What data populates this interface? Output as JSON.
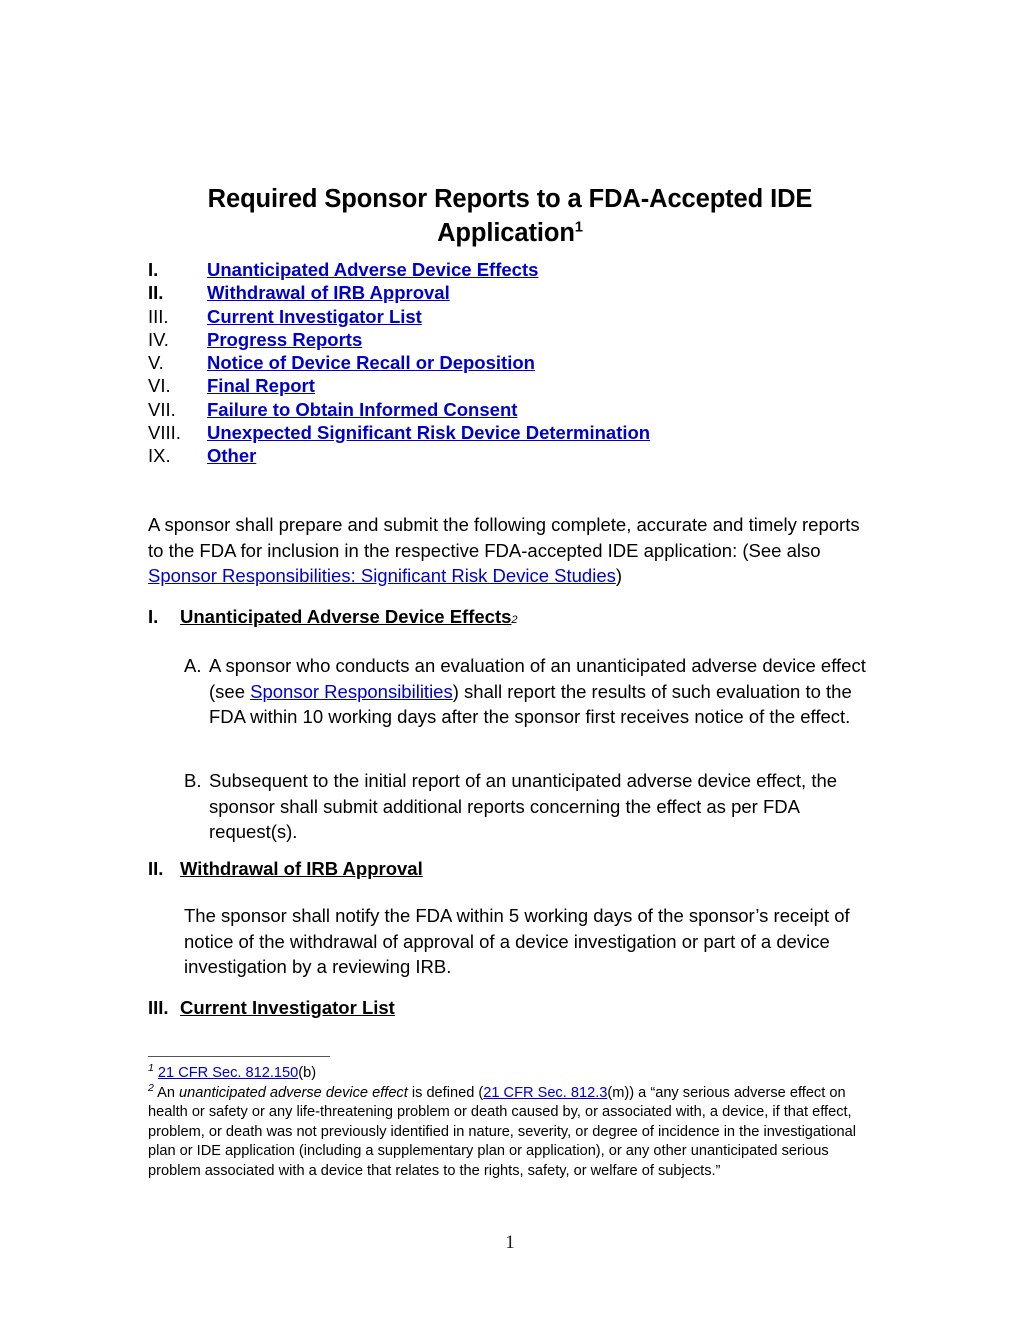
{
  "document": {
    "title_line1": "Required Sponsor Reports to a FDA-Accepted IDE",
    "title_line2": "Application",
    "title_footnote_marker": "1",
    "page_number": "1",
    "link_color": "#0000CC",
    "text_color": "#000000"
  },
  "toc": {
    "items": [
      {
        "numeral": "I.",
        "label": "Unanticipated Adverse Device Effects"
      },
      {
        "numeral": "II.",
        "label": "Withdrawal of IRB Approval"
      },
      {
        "numeral": "III.",
        "label": "Current Investigator List"
      },
      {
        "numeral": "IV.",
        "label": "Progress Reports"
      },
      {
        "numeral": "V.",
        "label": "Notice of Device Recall or Deposition"
      },
      {
        "numeral": "VI.",
        "label": "Final Report"
      },
      {
        "numeral": "VII.",
        "label": "Failure to Obtain Informed Consent"
      },
      {
        "numeral": "VIII.",
        "label": "Unexpected Significant Risk Device Determination"
      },
      {
        "numeral": "IX.",
        "label": "Other"
      }
    ]
  },
  "intro": {
    "text_before": "A sponsor shall prepare and submit the following complete, accurate and timely reports to the FDA for inclusion in the respective FDA-accepted IDE application: (See also ",
    "link": "Sponsor Responsibilities: Significant Risk Device Studies",
    "text_after": ")"
  },
  "sections": {
    "one": {
      "numeral": "I.",
      "title": "Unanticipated Adverse Device Effects",
      "footnote_marker": "2",
      "item_a": {
        "marker": "A.",
        "text_before": "A sponsor who conducts an evaluation of an unanticipated adverse device effect (see ",
        "link": "Sponsor Responsibilities",
        "text_after": ") shall report the results of such evaluation to the FDA within 10 working days after the sponsor first receives notice of the effect."
      },
      "item_b": {
        "marker": "B.",
        "text": "Subsequent to the initial report of an unanticipated adverse device effect, the sponsor shall submit additional reports concerning the effect as per FDA request(s)."
      }
    },
    "two": {
      "numeral": "II.",
      "title": "Withdrawal of IRB Approval",
      "paragraph": "The sponsor shall notify the FDA within 5 working days of the sponsor’s receipt of notice of the withdrawal of approval of a device investigation or part of a device investigation by a reviewing IRB."
    },
    "three": {
      "numeral": "III.",
      "title": "Current Investigator List"
    }
  },
  "footnotes": {
    "one": {
      "marker": "1",
      "link": "21 CFR Sec. 812.150",
      "text_after": "(b)"
    },
    "two": {
      "marker": "2",
      "text_before": "An ",
      "italic_term": "unanticipated adverse device effect",
      "text_mid": " is defined (",
      "link": "21 CFR Sec. 812.3",
      "text_after": "(m)) a “any serious adverse effect on health or safety or any life-threatening problem or death caused by, or associated with, a device, if that effect, problem, or death was not previously identified in nature, severity, or degree of incidence in the investigational plan or IDE application (including a supplementary plan or application), or any other unanticipated serious problem associated with a device that relates to the rights, safety, or welfare of subjects.”"
    }
  }
}
